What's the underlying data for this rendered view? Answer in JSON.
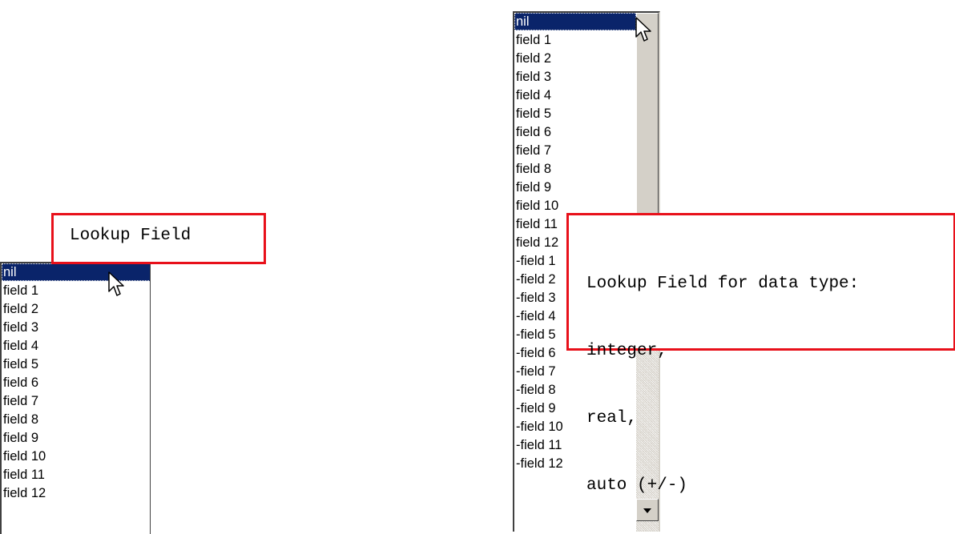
{
  "left_panel": {
    "callout_label": "Lookup Field",
    "list_items": [
      {
        "label": "nil",
        "selected": true
      },
      {
        "label": "field 1",
        "selected": false
      },
      {
        "label": "field 2",
        "selected": false
      },
      {
        "label": "field 3",
        "selected": false
      },
      {
        "label": "field 4",
        "selected": false
      },
      {
        "label": "field 5",
        "selected": false
      },
      {
        "label": "field 6",
        "selected": false
      },
      {
        "label": "field 7",
        "selected": false
      },
      {
        "label": "field 8",
        "selected": false
      },
      {
        "label": "field 9",
        "selected": false
      },
      {
        "label": "field 10",
        "selected": false
      },
      {
        "label": "field 11",
        "selected": false
      },
      {
        "label": "field 12",
        "selected": false
      }
    ]
  },
  "right_panel": {
    "callout_lines": [
      "Lookup Field for data type:",
      "integer,",
      "real,",
      "auto (+/-)"
    ],
    "list_items": [
      {
        "label": "nil",
        "selected": true
      },
      {
        "label": "field 1",
        "selected": false
      },
      {
        "label": "field 2",
        "selected": false
      },
      {
        "label": "field 3",
        "selected": false
      },
      {
        "label": "field 4",
        "selected": false
      },
      {
        "label": "field 5",
        "selected": false
      },
      {
        "label": "field 6",
        "selected": false
      },
      {
        "label": "field 7",
        "selected": false
      },
      {
        "label": "field 8",
        "selected": false
      },
      {
        "label": "field 9",
        "selected": false
      },
      {
        "label": "field 10",
        "selected": false
      },
      {
        "label": "field 11",
        "selected": false
      },
      {
        "label": "field 12",
        "selected": false
      },
      {
        "label": "-field 1",
        "selected": false
      },
      {
        "label": "-field 2",
        "selected": false
      },
      {
        "label": "-field 3",
        "selected": false
      },
      {
        "label": "-field 4",
        "selected": false
      },
      {
        "label": "-field 5",
        "selected": false
      },
      {
        "label": "-field 6",
        "selected": false
      },
      {
        "label": "-field 7",
        "selected": false
      },
      {
        "label": "-field 8",
        "selected": false
      },
      {
        "label": "-field 9",
        "selected": false
      },
      {
        "label": "-field 10",
        "selected": false
      },
      {
        "label": "-field 11",
        "selected": false
      },
      {
        "label": "-field 12",
        "selected": false
      }
    ]
  },
  "colors": {
    "selection_bg": "#0a246a",
    "callout_border": "#e8101a"
  },
  "icons": {
    "cursor": "mouse-pointer-icon",
    "scroll_down": "arrow-down-icon"
  }
}
